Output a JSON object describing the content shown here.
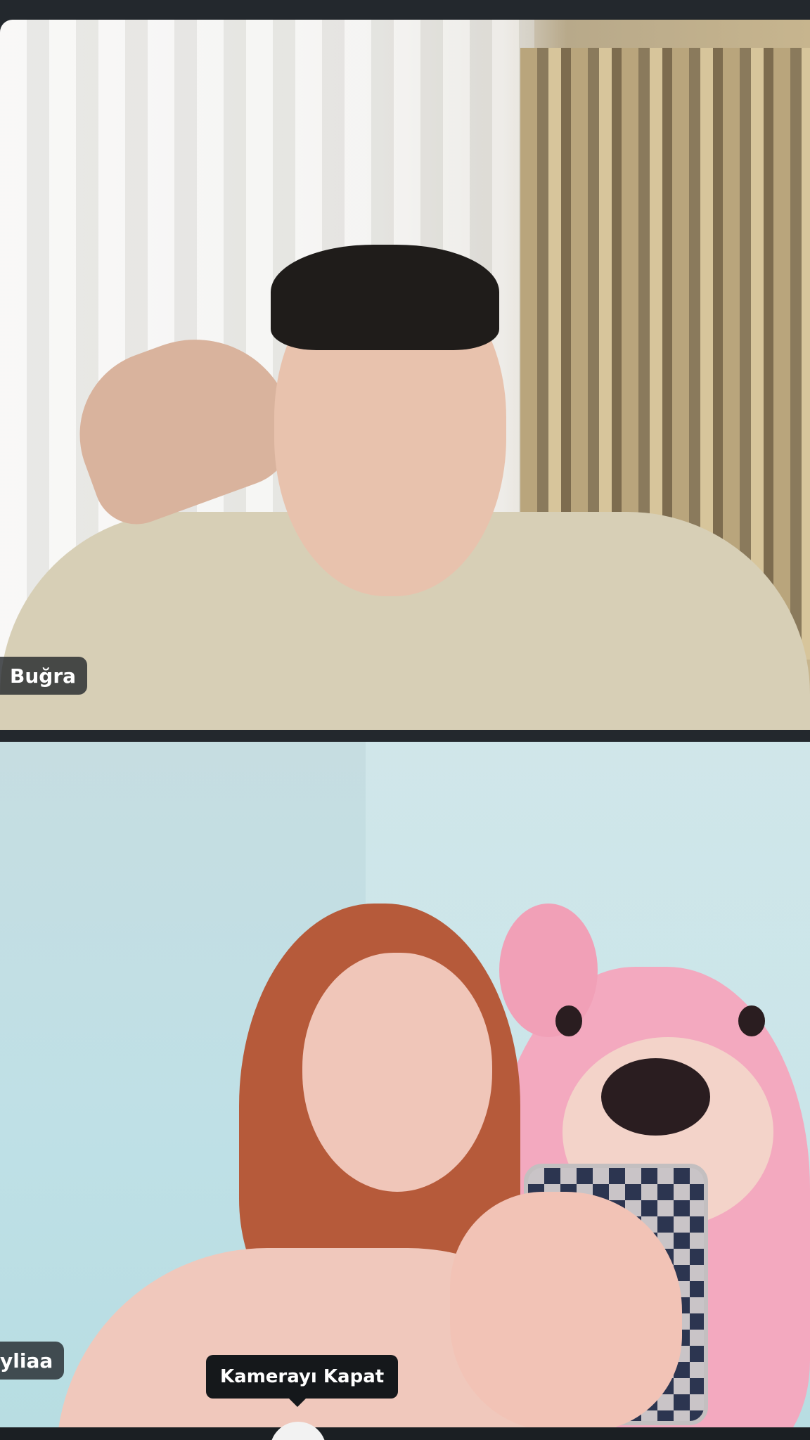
{
  "participants": [
    {
      "name": "Buğra",
      "camera": "on"
    },
    {
      "name": "yliaa",
      "camera": "on"
    }
  ],
  "controls": {
    "camera_tooltip": "Kamerayı Kapat",
    "camera_button_icon": "camera-icon"
  },
  "colors": {
    "tile_background": "#23282d",
    "name_tag_background": "#1e2126",
    "tooltip_background": "#15181b",
    "text": "#ffffff"
  }
}
